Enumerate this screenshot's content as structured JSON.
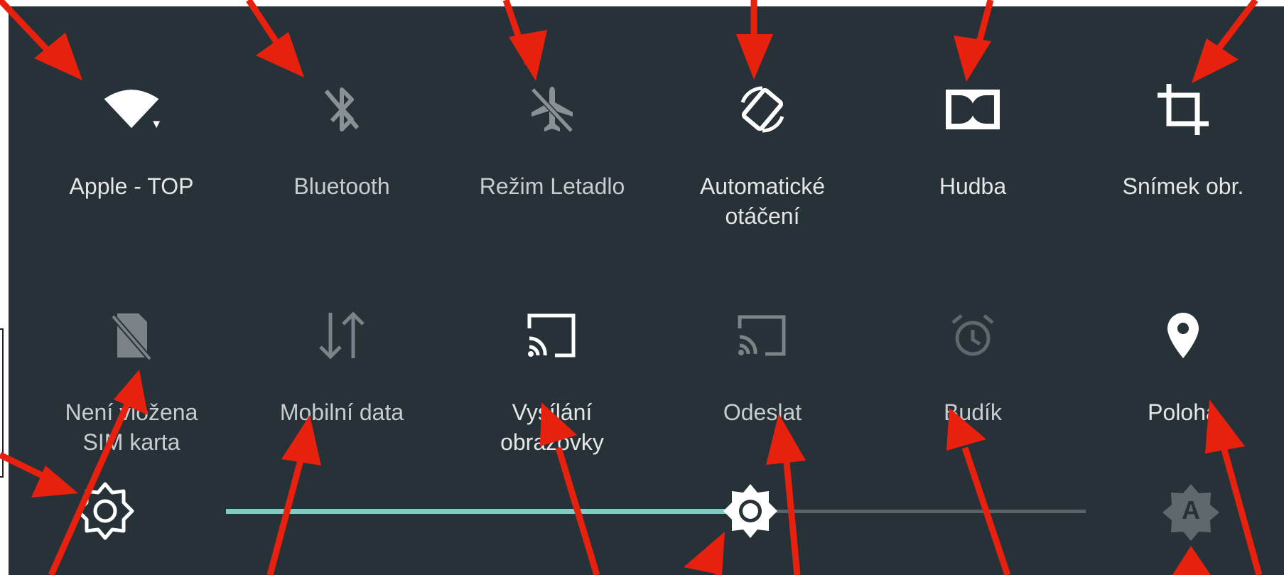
{
  "quick_settings": {
    "row1": [
      {
        "label": "Apple - TOP",
        "icon": "wifi-icon",
        "state": "on"
      },
      {
        "label": "Bluetooth",
        "icon": "bluetooth-off-icon",
        "state": "off"
      },
      {
        "label": "Režim Letadlo",
        "icon": "airplane-icon",
        "state": "off"
      },
      {
        "label": "Automatické\notáčení",
        "icon": "auto-rotate-icon",
        "state": "on"
      },
      {
        "label": "Hudba",
        "icon": "dolby-icon",
        "state": "on"
      },
      {
        "label": "Snímek obr.",
        "icon": "crop-icon",
        "state": "on"
      }
    ],
    "row2": [
      {
        "label": "Není vložena\nSIM karta",
        "icon": "no-sim-icon",
        "state": "off"
      },
      {
        "label": "Mobilní data",
        "icon": "mobile-data-icon",
        "state": "off"
      },
      {
        "label": "Vysílání\nobrazovky",
        "icon": "cast-icon",
        "state": "on"
      },
      {
        "label": "Odeslat",
        "icon": "cast-send-icon",
        "state": "off"
      },
      {
        "label": "Budík",
        "icon": "alarm-icon",
        "state": "off"
      },
      {
        "label": "Poloha",
        "icon": "location-icon",
        "state": "on"
      }
    ]
  },
  "brightness": {
    "level": 0.61,
    "icon_left": "brightness-icon",
    "icon_auto": "auto-brightness-icon",
    "auto_letter": "A"
  },
  "colors": {
    "panel_bg": "#263238",
    "accent": "#80cbc4",
    "track": "#5a6368",
    "annotation_arrow": "#e8210f"
  }
}
